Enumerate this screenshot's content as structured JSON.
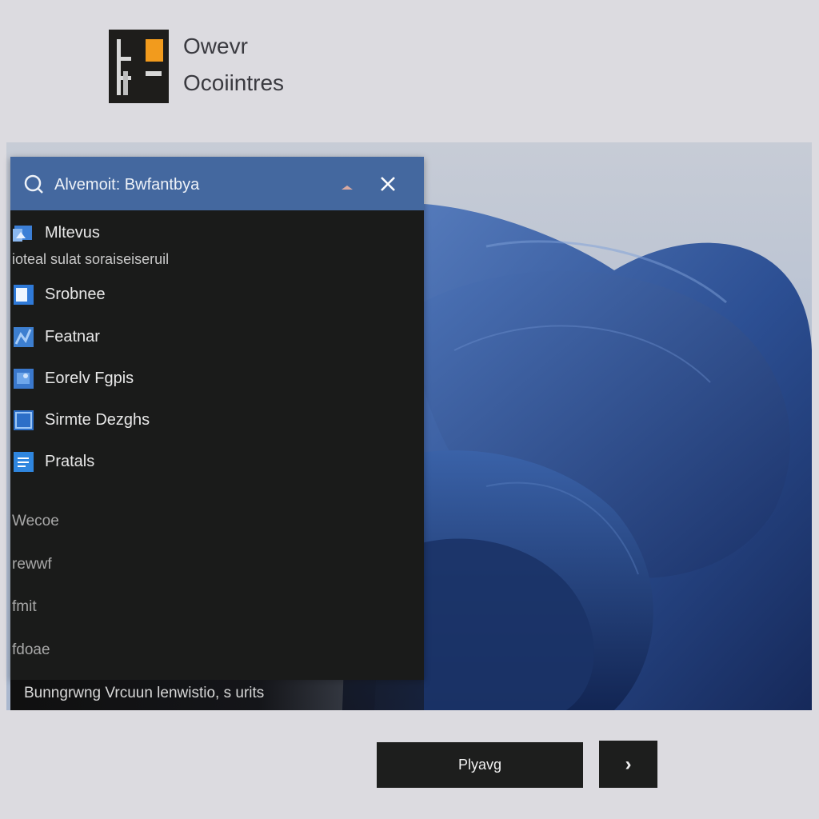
{
  "header": {
    "title": "Owevr",
    "subtitle": "Ocoiintres",
    "logo_icon": "app-logo-icon",
    "accent_color": "#f29b1d"
  },
  "panel": {
    "search_text": "Alvemoit: Bwfantbya",
    "header_color": "#44689f",
    "background_color": "#1a1b1a",
    "items": [
      {
        "label": "Mltevus",
        "icon": "image-folder-icon"
      },
      {
        "label": "Srobnee",
        "icon": "window-icon"
      },
      {
        "label": "Featnar",
        "icon": "puzzle-icon"
      },
      {
        "label": "Eorelv Fgpis",
        "icon": "photo-icon"
      },
      {
        "label": "Sirmte Dezghs",
        "icon": "document-icon"
      },
      {
        "label": "Pratals",
        "icon": "list-icon"
      }
    ],
    "item_description": "ioteal sulat soraiseiseruil",
    "sub_items": [
      "Wecoe",
      "rewwf",
      "fmit",
      "fdoae"
    ],
    "footer_text": "Bunngrwng Vrcuun lenwistio, s urits"
  },
  "buttons": {
    "primary_label": "Plyavg",
    "next_label": "›"
  }
}
